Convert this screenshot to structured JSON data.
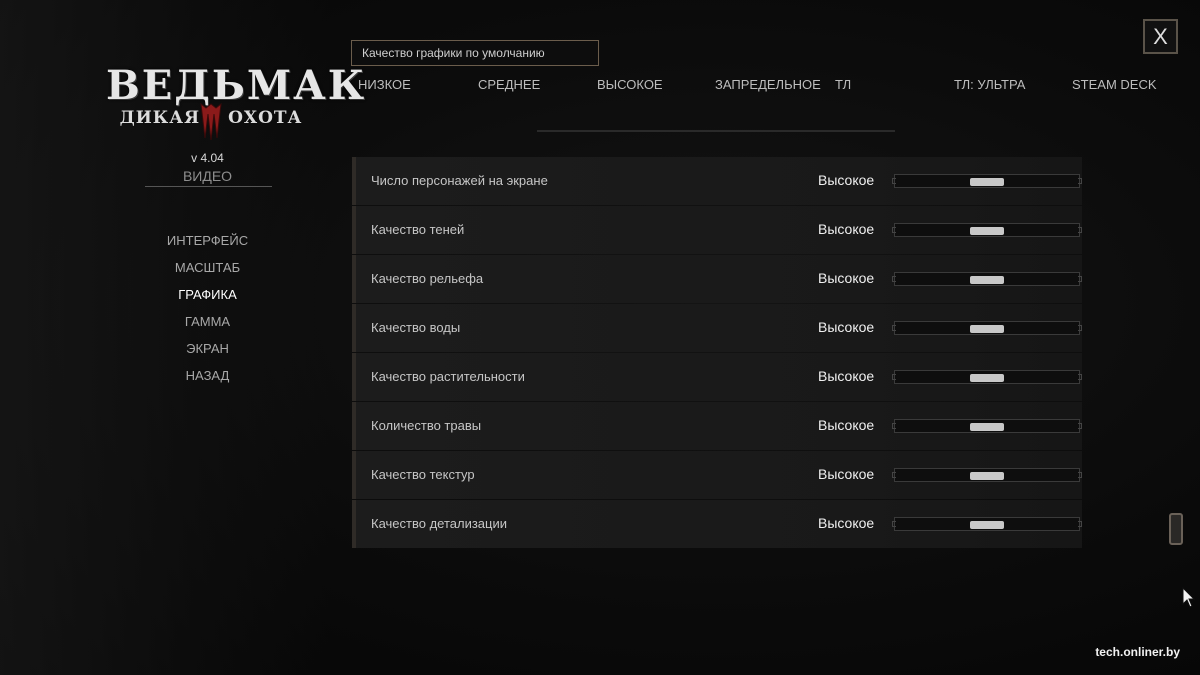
{
  "brand": {
    "title": "ВЕДЬМАК",
    "sub_left": "ДИКАЯ",
    "sub_right": "ОХОТА",
    "version": "v 4.04",
    "accent_red": "#8b1a1a"
  },
  "section": "ВИДЕО",
  "nav": {
    "items": [
      {
        "label": "ИНТЕРФЕЙС"
      },
      {
        "label": "МАСШТАБ"
      },
      {
        "label": "ГРАФИКА",
        "active": true
      },
      {
        "label": "ГАММА"
      },
      {
        "label": "ЭКРАН"
      },
      {
        "label": "НАЗАД"
      }
    ]
  },
  "preset": {
    "box_label": "Качество графики по умолчанию",
    "options": [
      "НИЗКОЕ",
      "СРЕДНЕЕ",
      "ВЫСОКОЕ",
      "ЗАПРЕДЕЛЬНОЕ",
      "ТЛ",
      "ТЛ: УЛЬТРА",
      "STEAM DECK"
    ]
  },
  "settings": {
    "rows": [
      {
        "label": "Число персонажей на экране",
        "value": "Высокое",
        "level": 0.5
      },
      {
        "label": "Качество теней",
        "value": "Высокое",
        "level": 0.5
      },
      {
        "label": "Качество рельефа",
        "value": "Высокое",
        "level": 0.5
      },
      {
        "label": "Качество воды",
        "value": "Высокое",
        "level": 0.5
      },
      {
        "label": "Качество растительности",
        "value": "Высокое",
        "level": 0.5
      },
      {
        "label": "Количество травы",
        "value": "Высокое",
        "level": 0.5
      },
      {
        "label": "Качество текстур",
        "value": "Высокое",
        "level": 0.5
      },
      {
        "label": "Качество детализации",
        "value": "Высокое",
        "level": 0.5
      }
    ]
  },
  "close": {
    "label": "X"
  },
  "watermark": "tech.onliner.by",
  "icons": {
    "close": "close-icon",
    "cursor": "cursor-arrow-icon",
    "logo_mark": "witcher-claw-icon"
  }
}
